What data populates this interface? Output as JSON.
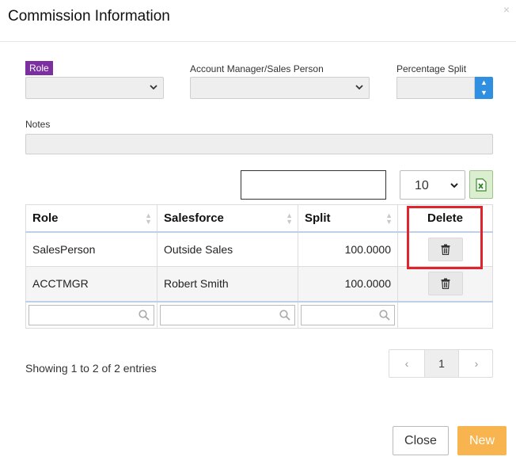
{
  "modal": {
    "title": "Commission Information",
    "close_glyph": "×"
  },
  "form": {
    "role_label": "Role",
    "role_value": "",
    "account_manager_label": "Account Manager/Sales Person",
    "account_manager_value": "",
    "percentage_split_label": "Percentage Split",
    "percentage_split_value": "",
    "notes_label": "Notes",
    "notes_value": ""
  },
  "table_controls": {
    "search_value": "",
    "page_length": "10",
    "export_icon": "excel-export-icon"
  },
  "table": {
    "columns": [
      "Role",
      "Salesforce",
      "Split",
      "Delete"
    ],
    "rows": [
      {
        "role": "SalesPerson",
        "salesforce": "Outside Sales",
        "split": "100.0000"
      },
      {
        "role": "ACCTMGR",
        "salesforce": "Robert Smith",
        "split": "100.0000"
      }
    ]
  },
  "footer": {
    "info": "Showing 1 to 2 of 2 entries",
    "prev_glyph": "‹",
    "current_page": "1",
    "next_glyph": "›",
    "close_label": "Close",
    "new_label": "New"
  },
  "colors": {
    "role_label_bg": "#7b2fa0",
    "spinner": "#2f8fe0",
    "new_button": "#f7b44f",
    "highlight": "#e0242e"
  }
}
